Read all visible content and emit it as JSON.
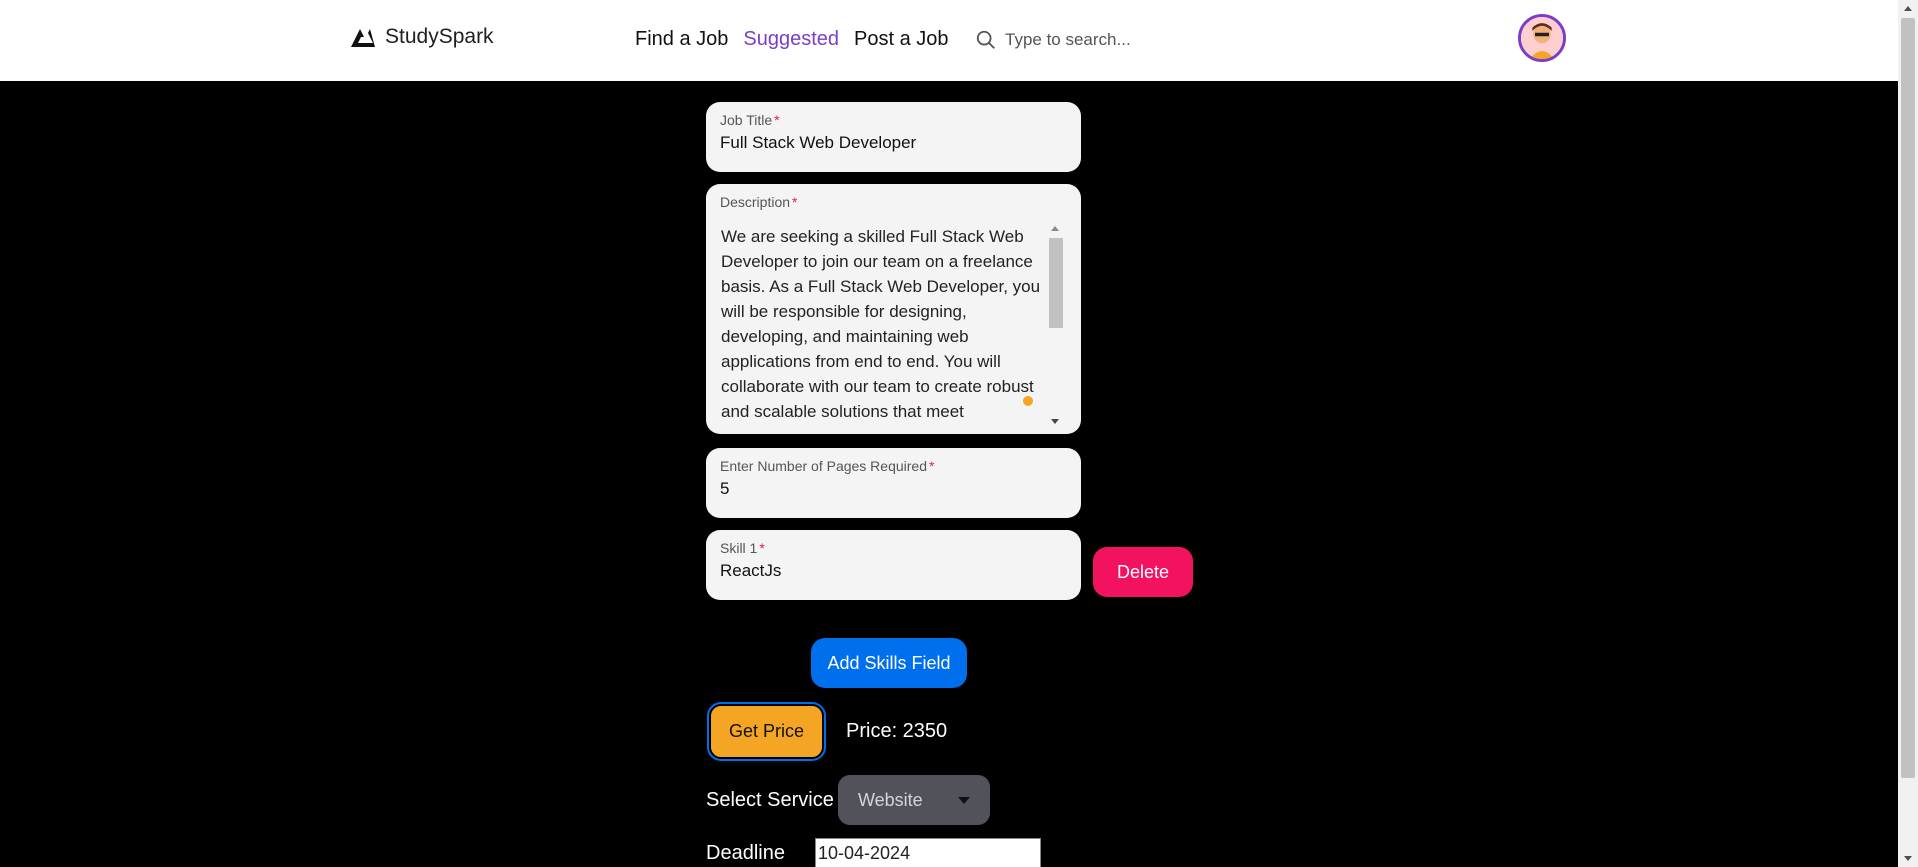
{
  "header": {
    "brand": "StudySpark",
    "nav": [
      "Find a Job",
      "Suggested",
      "Post a Job"
    ],
    "active_nav": "Suggested",
    "search_placeholder": "Type to search...",
    "accent_color": "#7b3fc7"
  },
  "form": {
    "job_title": {
      "label": "Job Title",
      "required_mark": "*",
      "value": "Full Stack Web Developer"
    },
    "description": {
      "label": "Description",
      "required_mark": "*",
      "value": "We are seeking a skilled Full Stack Web Developer to join our team on a freelance basis. As a Full Stack Web Developer, you will be responsible for designing, developing, and maintaining web applications from end to end. You will collaborate with our team to create robust and scalable solutions that meet"
    },
    "pages": {
      "label": "Enter Number of Pages Required",
      "required_mark": "*",
      "value": "5"
    },
    "skill": {
      "label": "Skill 1",
      "required_mark": "*",
      "value": "ReactJs"
    },
    "delete_label": "Delete",
    "add_skills_label": "Add Skills Field",
    "get_price_label": "Get Price",
    "price_text": "Price: 2350",
    "service_label": "Select Service",
    "service_value": "Website",
    "deadline_label": "Deadline",
    "deadline_value": "10-04-2024"
  },
  "colors": {
    "delete": "#f31260",
    "add": "#006fee",
    "price": "#f5a524",
    "page_bg": "#000000"
  }
}
